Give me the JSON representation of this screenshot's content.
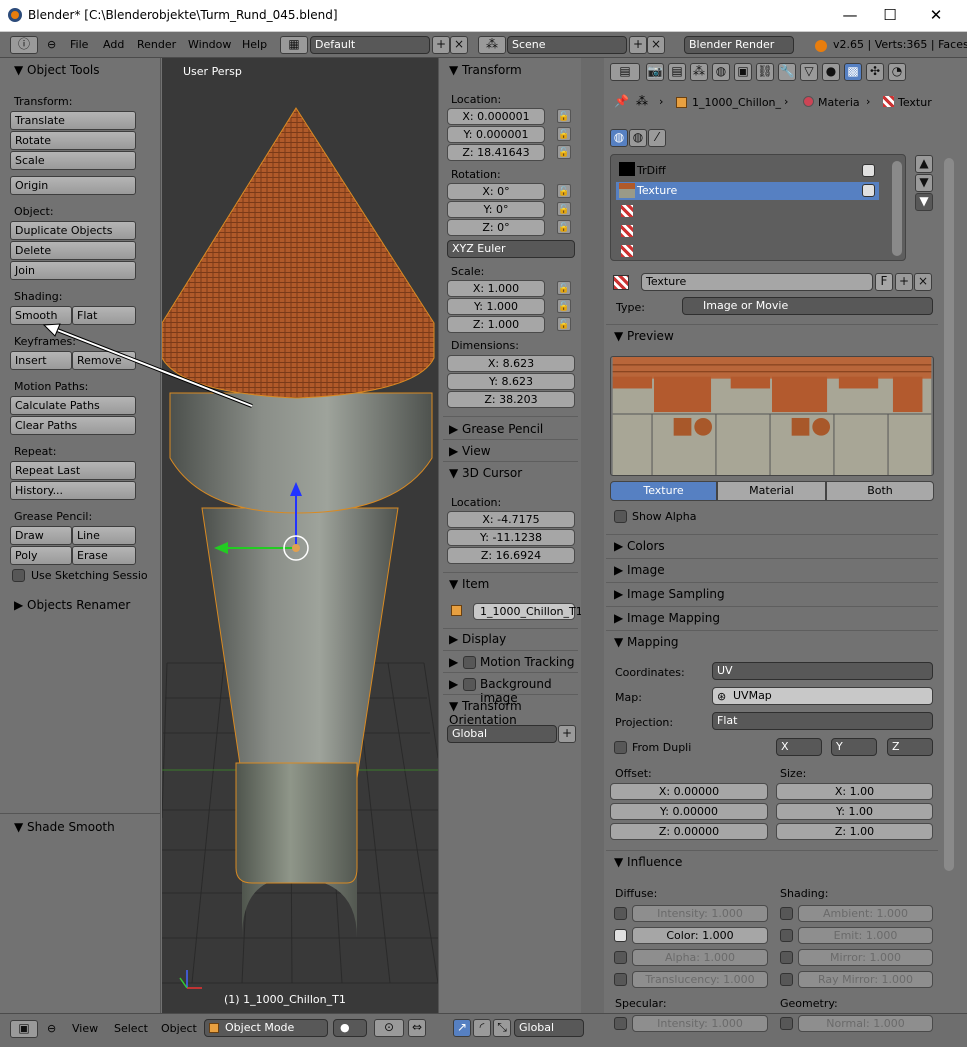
{
  "window": {
    "title": "Blender* [C:\\Blenderobjekte\\Turm_Rund_045.blend]",
    "minimize": "—",
    "maximize": "☐",
    "close": "✕"
  },
  "topbar": {
    "menus": [
      "File",
      "Add",
      "Render",
      "Window",
      "Help"
    ],
    "layout": "Default",
    "scene": "Scene",
    "engine": "Blender Render",
    "stats": "v2.65 | Verts:365 | Faces"
  },
  "tools": {
    "header": "Object Tools",
    "transform": "Transform:",
    "translate": "Translate",
    "rotate": "Rotate",
    "scale": "Scale",
    "origin": "Origin",
    "object": "Object:",
    "duplicate": "Duplicate Objects",
    "delete": "Delete",
    "join": "Join",
    "shading": "Shading:",
    "smooth": "Smooth",
    "flat": "Flat",
    "keyframes": "Keyframes:",
    "insert": "Insert",
    "remove": "Remove",
    "motion_paths": "Motion Paths:",
    "calc_paths": "Calculate Paths",
    "clear_paths": "Clear Paths",
    "repeat": "Repeat:",
    "repeat_last": "Repeat Last",
    "history": "History...",
    "grease": "Grease Pencil:",
    "draw": "Draw",
    "line": "Line",
    "poly": "Poly",
    "erase": "Erase",
    "sketching": "Use Sketching Sessio",
    "renamer": "Objects Renamer",
    "shade_smooth": "Shade Smooth"
  },
  "viewport": {
    "label": "User Persp",
    "object_label": "(1) 1_1000_Chillon_T1"
  },
  "npanel": {
    "transform": "Transform",
    "location": "Location:",
    "loc_x": "X: 0.000001",
    "loc_y": "Y: 0.000001",
    "loc_z": "Z: 18.41643",
    "rotation": "Rotation:",
    "rot_x": "X: 0°",
    "rot_y": "Y: 0°",
    "rot_z": "Z: 0°",
    "euler": "XYZ Euler",
    "scale": "Scale:",
    "sc_x": "X: 1.000",
    "sc_y": "Y: 1.000",
    "sc_z": "Z: 1.000",
    "dimensions": "Dimensions:",
    "dim_x": "X: 8.623",
    "dim_y": "Y: 8.623",
    "dim_z": "Z: 38.203",
    "grease_pencil": "Grease Pencil",
    "view": "View",
    "cursor": "3D Cursor",
    "cursor_location": "Location:",
    "cur_x": "X: -4.7175",
    "cur_y": "Y: -11.1238",
    "cur_z": "Z: 16.6924",
    "item": "Item",
    "item_name": "1_1000_Chillon_T1",
    "display": "Display",
    "motion_tracking": "Motion Tracking",
    "background_image": "Background Image",
    "transform_orientation": "Transform Orientation",
    "orientation": "Global"
  },
  "props": {
    "breadcrumb": [
      "1_1000_Chillon_",
      "Materia",
      "Textur"
    ],
    "slots": [
      "TrDiff",
      "Texture"
    ],
    "texture_name": "Texture",
    "fake_user": "F",
    "type_label": "Type:",
    "type_value": "Image or Movie",
    "preview": "Preview",
    "tabs": [
      "Texture",
      "Material",
      "Both"
    ],
    "show_alpha": "Show Alpha",
    "colors": "Colors",
    "image": "Image",
    "image_sampling": "Image Sampling",
    "image_mapping": "Image Mapping",
    "mapping": "Mapping",
    "coordinates_label": "Coordinates:",
    "coordinates": "UV",
    "map_label": "Map:",
    "map": "UVMap",
    "projection_label": "Projection:",
    "projection": "Flat",
    "from_dupli": "From Dupli",
    "axis_x": "X",
    "axis_y": "Y",
    "axis_z": "Z",
    "offset": "Offset:",
    "off_x": "X: 0.00000",
    "off_y": "Y: 0.00000",
    "off_z": "Z: 0.00000",
    "size": "Size:",
    "size_x": "X: 1.00",
    "size_y": "Y: 1.00",
    "size_z": "Z: 1.00",
    "influence": "Influence",
    "diffuse": "Diffuse:",
    "intensity": "Intensity: 1.000",
    "color": "Color: 1.000",
    "alpha": "Alpha: 1.000",
    "translucency": "Translucency: 1.000",
    "shading": "Shading:",
    "ambient": "Ambient: 1.000",
    "emit": "Emit: 1.000",
    "mirror": "Mirror: 1.000",
    "ray_mirror": "Ray Mirror: 1.000",
    "specular": "Specular:",
    "spec_intensity": "Intensity: 1.000",
    "geometry": "Geometry:",
    "normal": "Normal: 1.000"
  },
  "bottombar": {
    "view": "View",
    "select": "Select",
    "object": "Object",
    "mode": "Object Mode",
    "orientation": "Global"
  },
  "colors": {
    "selected": "#5680c2",
    "roof": "#b05a2a",
    "panel": "#727272"
  }
}
